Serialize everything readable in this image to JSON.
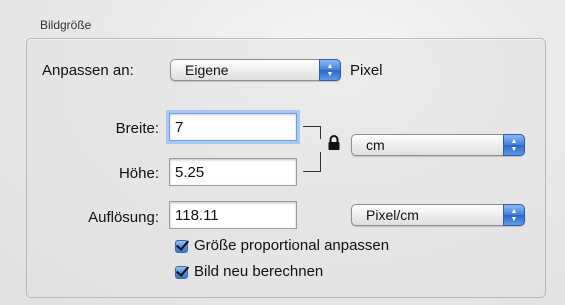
{
  "section": {
    "title": "Bildgröße"
  },
  "fit": {
    "label": "Anpassen an:",
    "value": "Eigene",
    "unit": "Pixel"
  },
  "width": {
    "label": "Breite:",
    "value": "7"
  },
  "height": {
    "label": "Höhe:",
    "value": "5.25"
  },
  "size_unit": {
    "value": "cm"
  },
  "resolution": {
    "label": "Auflösung:",
    "value": "118.11",
    "unit": "Pixel/cm"
  },
  "options": {
    "proportional": {
      "label": "Größe proportional anpassen",
      "checked": true
    },
    "resample": {
      "label": "Bild neu berechnen",
      "checked": true
    }
  },
  "icons": {
    "lock": "lock-icon",
    "stepper": "up-down-arrows-icon",
    "check": "checkmark-icon"
  },
  "colors": {
    "accent": "#3f7fdc",
    "focus_ring": "#a9c8f3"
  }
}
